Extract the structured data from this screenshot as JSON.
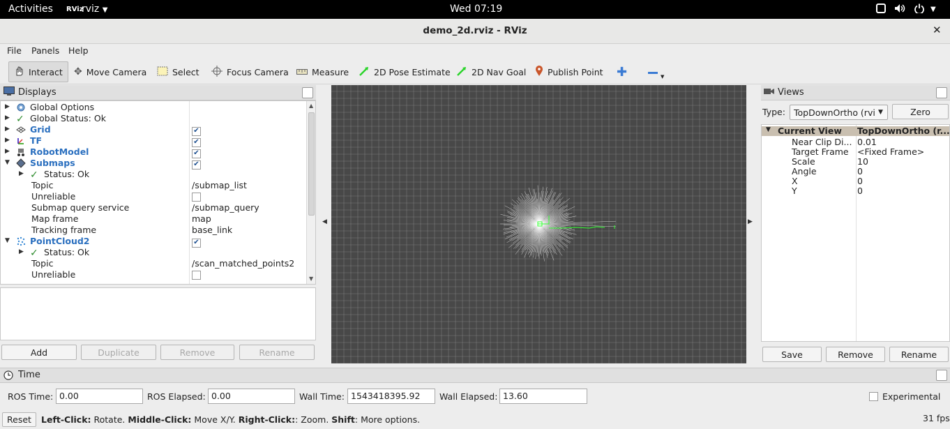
{
  "system_bar": {
    "activities": "Activities",
    "app_name": "rviz",
    "app_icon_text": "RViz",
    "clock": "Wed 07:19"
  },
  "window": {
    "title": "demo_2d.rviz - RViz"
  },
  "menu": [
    "File",
    "Panels",
    "Help"
  ],
  "toolbar": [
    "Interact",
    "Move Camera",
    "Select",
    "Focus Camera",
    "Measure",
    "2D Pose Estimate",
    "2D Nav Goal",
    "Publish Point"
  ],
  "displays": {
    "title": "Displays",
    "rows": [
      {
        "arrow": "right",
        "icon": "gear",
        "label": "Global Options",
        "value": "",
        "checkbox": null,
        "indent": 0,
        "bold": false
      },
      {
        "arrow": "right",
        "icon": "check",
        "label": "Global Status: Ok",
        "value": "",
        "checkbox": null,
        "indent": 0,
        "bold": false
      },
      {
        "arrow": "right",
        "icon": "grid",
        "label": "Grid",
        "value": "",
        "checkbox": true,
        "indent": 0,
        "bold": true
      },
      {
        "arrow": "right",
        "icon": "tf",
        "label": "TF",
        "value": "",
        "checkbox": true,
        "indent": 0,
        "bold": true
      },
      {
        "arrow": "right",
        "icon": "robot",
        "label": "RobotModel",
        "value": "",
        "checkbox": true,
        "indent": 0,
        "bold": true
      },
      {
        "arrow": "down",
        "icon": "diamond",
        "label": "Submaps",
        "value": "",
        "checkbox": true,
        "indent": 0,
        "bold": true
      },
      {
        "arrow": "right",
        "icon": "check",
        "label": "Status: Ok",
        "value": "",
        "checkbox": null,
        "indent": 1,
        "bold": false
      },
      {
        "arrow": "",
        "icon": "",
        "label": "Topic",
        "value": "/submap_list",
        "checkbox": null,
        "indent": 1,
        "bold": false
      },
      {
        "arrow": "",
        "icon": "",
        "label": "Unreliable",
        "value": "",
        "checkbox": false,
        "indent": 1,
        "bold": false
      },
      {
        "arrow": "",
        "icon": "",
        "label": "Submap query service",
        "value": "/submap_query",
        "checkbox": null,
        "indent": 1,
        "bold": false
      },
      {
        "arrow": "",
        "icon": "",
        "label": "Map frame",
        "value": "map",
        "checkbox": null,
        "indent": 1,
        "bold": false
      },
      {
        "arrow": "",
        "icon": "",
        "label": "Tracking frame",
        "value": "base_link",
        "checkbox": null,
        "indent": 1,
        "bold": false
      },
      {
        "arrow": "down",
        "icon": "cloud",
        "label": "PointCloud2",
        "value": "",
        "checkbox": true,
        "indent": 0,
        "bold": true
      },
      {
        "arrow": "right",
        "icon": "check",
        "label": "Status: Ok",
        "value": "",
        "checkbox": null,
        "indent": 1,
        "bold": false
      },
      {
        "arrow": "",
        "icon": "",
        "label": "Topic",
        "value": "/scan_matched_points2",
        "checkbox": null,
        "indent": 1,
        "bold": false
      },
      {
        "arrow": "",
        "icon": "",
        "label": "Unreliable",
        "value": "",
        "checkbox": false,
        "indent": 1,
        "bold": false
      }
    ],
    "buttons": [
      "Add",
      "Duplicate",
      "Remove",
      "Rename"
    ]
  },
  "views": {
    "title": "Views",
    "type_label": "Type:",
    "type_value": "TopDownOrtho (rvi",
    "zero_button": "Zero",
    "current_view": "Current View",
    "current_view_type": "TopDownOrtho (r...",
    "props": [
      {
        "key": "Near Clip Di...",
        "value": "0.01"
      },
      {
        "key": "Target Frame",
        "value": "<Fixed Frame>"
      },
      {
        "key": "Scale",
        "value": "10"
      },
      {
        "key": "Angle",
        "value": "0"
      },
      {
        "key": "X",
        "value": "0"
      },
      {
        "key": "Y",
        "value": "0"
      }
    ],
    "buttons": [
      "Save",
      "Remove",
      "Rename"
    ]
  },
  "time": {
    "title": "Time",
    "ros_time_label": "ROS Time:",
    "ros_time": "0.00",
    "ros_elapsed_label": "ROS Elapsed:",
    "ros_elapsed": "0.00",
    "wall_time_label": "Wall Time:",
    "wall_time": "1543418395.92",
    "wall_elapsed_label": "Wall Elapsed:",
    "wall_elapsed": "13.60",
    "experimental": "Experimental"
  },
  "status": {
    "reset": "Reset",
    "hint_parts": [
      {
        "b": "Left-Click:",
        "t": " Rotate. "
      },
      {
        "b": "Middle-Click:",
        "t": " Move X/Y. "
      },
      {
        "b": "Right-Click:",
        "t": ": Zoom. "
      },
      {
        "b": "Shift",
        "t": ": More options."
      }
    ],
    "fps": "31 fps"
  },
  "colors": {
    "viewport_bg": "#484848",
    "grid": "#a0a0a0",
    "scan": "#ffffff",
    "robot": "#33ff33",
    "accent": "#2a6fbf"
  }
}
